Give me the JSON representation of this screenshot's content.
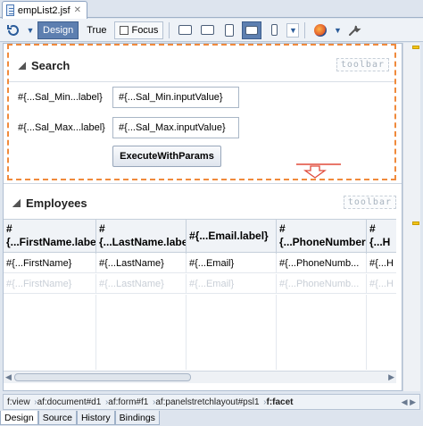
{
  "editor_tab": {
    "title": "empList2.jsf",
    "close": "✕"
  },
  "toolbar": {
    "design_label": "Design",
    "true_label": "True",
    "focus_label": "Focus"
  },
  "search": {
    "title": "Search",
    "facet_label": "toolbar",
    "min_label": "#{...Sal_Min...label}",
    "min_value": "#{...Sal_Min.inputValue}",
    "max_label": "#{...Sal_Max...label}",
    "max_value": "#{...Sal_Max.inputValue}",
    "execute_label": "ExecuteWithParams"
  },
  "employees": {
    "title": "Employees",
    "facet_label": "toolbar",
    "columns": [
      {
        "hash": "#",
        "label": "{...FirstName.labe"
      },
      {
        "hash": "#",
        "label": "{...LastName.labe"
      },
      {
        "hash": "",
        "label": "#{...Email.label}"
      },
      {
        "hash": "#",
        "label": "{...PhoneNumber"
      },
      {
        "hash": "#",
        "label": "{...H"
      }
    ],
    "row": [
      "#{...FirstName}",
      "#{...LastName}",
      "#{...Email}",
      "#{...PhoneNumb...",
      "#{...H"
    ],
    "ghost_row": [
      "#{...FirstName}",
      "#{...LastName}",
      "#{...Email}",
      "#{...PhoneNumb...",
      "#{...H"
    ]
  },
  "breadcrumbs": [
    "f:view",
    "af:document#d1",
    "af:form#f1",
    "af:panelstretchlayout#psl1",
    "f:facet"
  ],
  "bottom_tabs": [
    "Design",
    "Source",
    "History",
    "Bindings"
  ]
}
